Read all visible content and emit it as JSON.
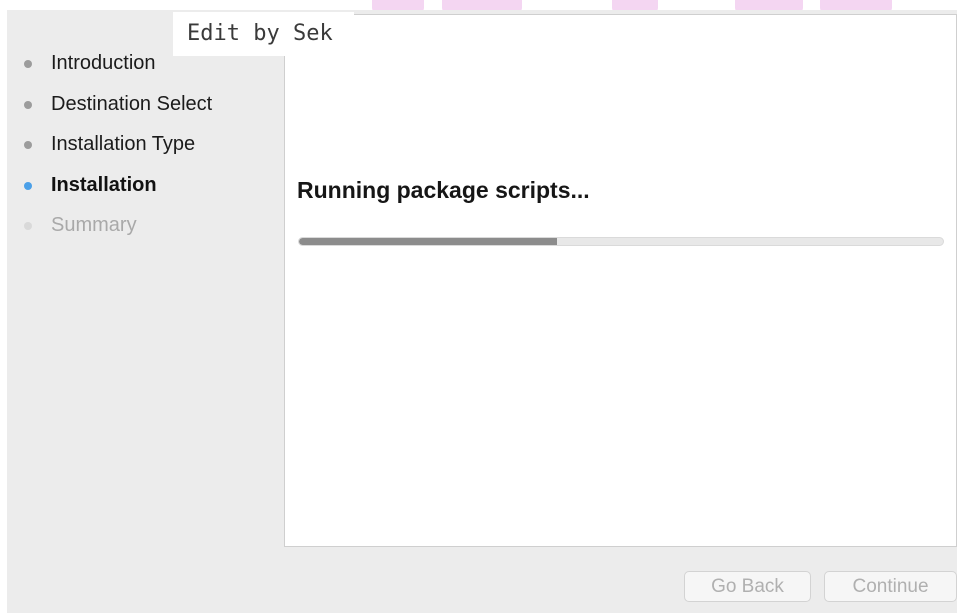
{
  "overlay": {
    "caption": "Edit by Sek"
  },
  "sidebar": {
    "steps": [
      {
        "label": "Introduction",
        "state": "done"
      },
      {
        "label": "Destination Select",
        "state": "done"
      },
      {
        "label": "Installation Type",
        "state": "done"
      },
      {
        "label": "Installation",
        "state": "current"
      },
      {
        "label": "Summary",
        "state": "pending"
      }
    ]
  },
  "main": {
    "status_text": "Running package scripts...",
    "progress_fraction": 0.4
  },
  "buttons": {
    "back_label": "Go Back",
    "continue_label": "Continue"
  },
  "colors": {
    "active_step_dot": "#4ba0e8",
    "progress_fill": "#8c8c8c"
  }
}
